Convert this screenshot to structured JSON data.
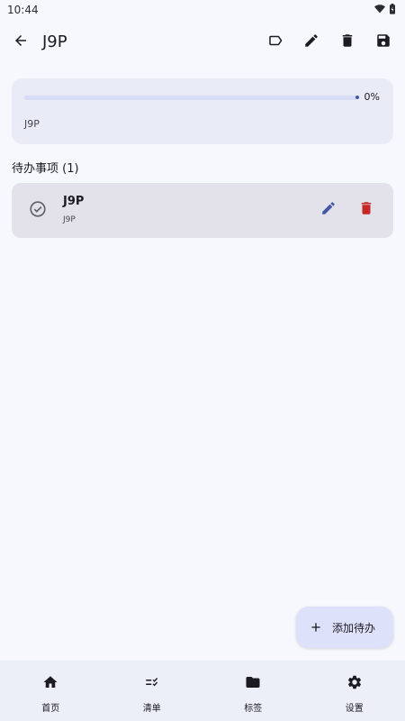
{
  "status_bar": {
    "time": "10:44"
  },
  "app_bar": {
    "title": "J9P"
  },
  "progress": {
    "percent_label": "0%",
    "value": 0,
    "name": "J9P"
  },
  "section": {
    "title": "待办事项 (1)"
  },
  "todos": [
    {
      "title": "J9P",
      "subtitle": "J9P"
    }
  ],
  "fab": {
    "label": "添加待办"
  },
  "bottom_nav": [
    {
      "label": "首页",
      "icon": "home-icon"
    },
    {
      "label": "清单",
      "icon": "checklist-icon"
    },
    {
      "label": "标签",
      "icon": "folder-icon"
    },
    {
      "label": "设置",
      "icon": "gear-icon"
    }
  ],
  "colors": {
    "accent": "#4557a1",
    "delete": "#c62828",
    "background": "#f7f8fe",
    "card": "#e9ebf6",
    "todo_card": "#e3e2ea",
    "fab": "#dde1fa"
  }
}
